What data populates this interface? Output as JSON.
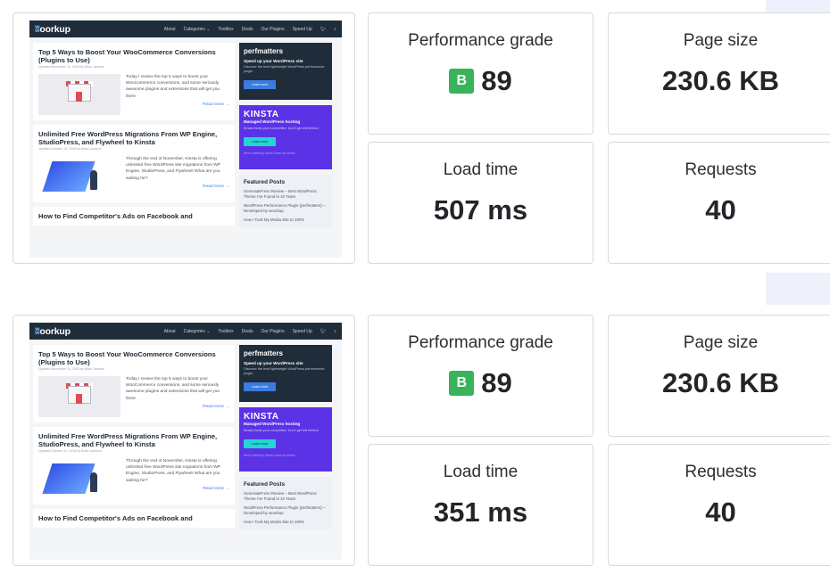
{
  "site": {
    "logo": "oorkup",
    "menu": [
      "About",
      "Categories ⌄",
      "Toolbox",
      "Deals",
      "Our Plugins",
      "Speed Up"
    ],
    "posts": [
      {
        "title": "Top 5 Ways to Boost Your WooCommerce Conversions (Plugins to Use)",
        "meta": "Updated November 11, 2018 by Brian Jackson",
        "excerpt": "Today I review the top 5 ways to boost your WooCommerce conversions, and some seriously awesome plugins and extensions that will get you there.",
        "read_more": "Read more →"
      },
      {
        "title": "Unlimited Free WordPress Migrations From WP Engine, StudioPress, and Flywheel to Kinsta",
        "meta": "Updated October 31, 2018 by Brian Jackson",
        "excerpt": "Through the end of November, Kinsta is offering unlimited free WordPress site migrations from WP Engine, StudioPress, and Flywheel! What are you waiting for?",
        "read_more": "Read more →"
      },
      {
        "title": "How to Find Competitor's Ads on Facebook and"
      }
    ],
    "sidebar": {
      "perfmatters": {
        "brand": "perfmatters",
        "heading": "Speed up your WordPress site",
        "desc": "Discover the best lightweight WordPress performance plugin.",
        "button": "Learn more"
      },
      "kinsta": {
        "brand": "KINSTA",
        "heading": "Managed WordPress hosting",
        "desc": "Kinsta hosts your competitor. Don't get left behind.",
        "button": "Learn more",
        "foot": "We're hosted by Kinsta. Read our review"
      },
      "featured": {
        "heading": "Featured Posts",
        "items": [
          "GeneratePress Review – Best WordPress Theme I've Found in 10 Years",
          "WordPress Performance Plugin (perfmatters) – Developed by woorkup",
          "How I Took My Media Site to 100%"
        ]
      }
    }
  },
  "results": [
    {
      "performance_label": "Performance grade",
      "grade_letter": "B",
      "grade_score": "89",
      "page_size_label": "Page size",
      "page_size_value": "230.6 KB",
      "load_time_label": "Load time",
      "load_time_value": "507 ms",
      "requests_label": "Requests",
      "requests_value": "40"
    },
    {
      "performance_label": "Performance grade",
      "grade_letter": "B",
      "grade_score": "89",
      "page_size_label": "Page size",
      "page_size_value": "230.6 KB",
      "load_time_label": "Load time",
      "load_time_value": "351 ms",
      "requests_label": "Requests",
      "requests_value": "40"
    }
  ],
  "colors": {
    "grade_badge": "#38b35a",
    "card_border": "#d7d9de",
    "nav_bg": "#1f2c3a",
    "kinsta_purple": "#5b32e6"
  }
}
